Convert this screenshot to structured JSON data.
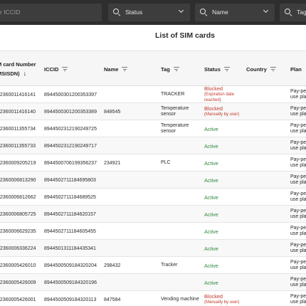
{
  "filters": {
    "iccid_placeholder": "r ICCID",
    "status_placeholder": "Status",
    "name_placeholder": "Name",
    "tag_placeholder": "Tag"
  },
  "page_title": "List of SIM cards",
  "columns": {
    "msisdn_line1": "M card Number",
    "msisdn_line2": "MSISDN)",
    "iccid": "ICCID",
    "name": "Name",
    "tag": "Tag",
    "status": "Status",
    "country": "Country",
    "plan": "Plan"
  },
  "rows": [
    {
      "msisdn": "32360011416141",
      "iccid": "8944500301200353397",
      "name": "",
      "tag": "TRACKER",
      "status": "Blocked",
      "status_sub": "(Expiration date reached)",
      "status_type": "blocked",
      "plan": "Pay-per-use plan"
    },
    {
      "msisdn": "32360011416140",
      "iccid": "8944500301200353389",
      "name": "848545",
      "tag": "Temperature sensor",
      "status": "Blocked",
      "status_sub": "(Manually by user)",
      "status_type": "blocked",
      "plan": "Pay-per-use plan"
    },
    {
      "msisdn": "32360011355734",
      "iccid": "8944502312190249725",
      "name": "",
      "tag": "Temperature sensor",
      "status": "Active",
      "status_sub": "",
      "status_type": "active",
      "plan": "Pay-per-use plan"
    },
    {
      "msisdn": "32360011355733",
      "iccid": "8944502312190249717",
      "name": "",
      "tag": "",
      "status": "Active",
      "status_sub": "",
      "status_type": "active",
      "plan": "Pay-per-use plan"
    },
    {
      "msisdn": "32360009205219",
      "iccid": "8944500706199356237",
      "name": "234921",
      "tag": "PLC",
      "status": "Active",
      "status_sub": "",
      "status_type": "active",
      "plan": "Pay-per-use plan"
    },
    {
      "msisdn": "32360006813290",
      "iccid": "8944502711184695803",
      "name": "",
      "tag": "",
      "status": "Active",
      "status_sub": "",
      "status_type": "active",
      "plan": "Pay-per-use plan"
    },
    {
      "msisdn": "32360006812662",
      "iccid": "8944502711184689525",
      "name": "",
      "tag": "",
      "status": "Active",
      "status_sub": "",
      "status_type": "active",
      "plan": "Pay-per-use plan"
    },
    {
      "msisdn": "32360006805725",
      "iccid": "8944502711184620157",
      "name": "",
      "tag": "",
      "status": "Active",
      "status_sub": "",
      "status_type": "active",
      "plan": "Pay-per-use plan"
    },
    {
      "msisdn": "32360006629235",
      "iccid": "8944502711184605455",
      "name": "",
      "tag": "",
      "status": "Active",
      "status_sub": "",
      "status_type": "active",
      "plan": "Pay-per-use plan"
    },
    {
      "msisdn": "32360006336224",
      "iccid": "8944501311184435341",
      "name": "",
      "tag": "",
      "status": "Active",
      "status_sub": "",
      "status_type": "active",
      "plan": "Pay-per-use plan"
    },
    {
      "msisdn": "32360005426010",
      "iccid": "8944500509184320204",
      "name": "298432",
      "tag": "Tracker",
      "status": "Active",
      "status_sub": "",
      "status_type": "active",
      "plan": "Pay-per-use plan"
    },
    {
      "msisdn": "32360005426009",
      "iccid": "8944500509184320196",
      "name": "",
      "tag": "",
      "status": "Active",
      "status_sub": "",
      "status_type": "active",
      "plan": "Pay-per-use plan"
    },
    {
      "msisdn": "32360005426001",
      "iccid": "8944500509184320113",
      "name": "847584",
      "tag": "Vending machine",
      "status": "Blocked",
      "status_sub": "(Manually by user)",
      "status_type": "blocked",
      "plan": "Pay-per-use plan"
    }
  ],
  "colors": {
    "filter_bar": "#2e2e2e",
    "active": "#2f8a3c",
    "blocked": "#c0392b"
  }
}
